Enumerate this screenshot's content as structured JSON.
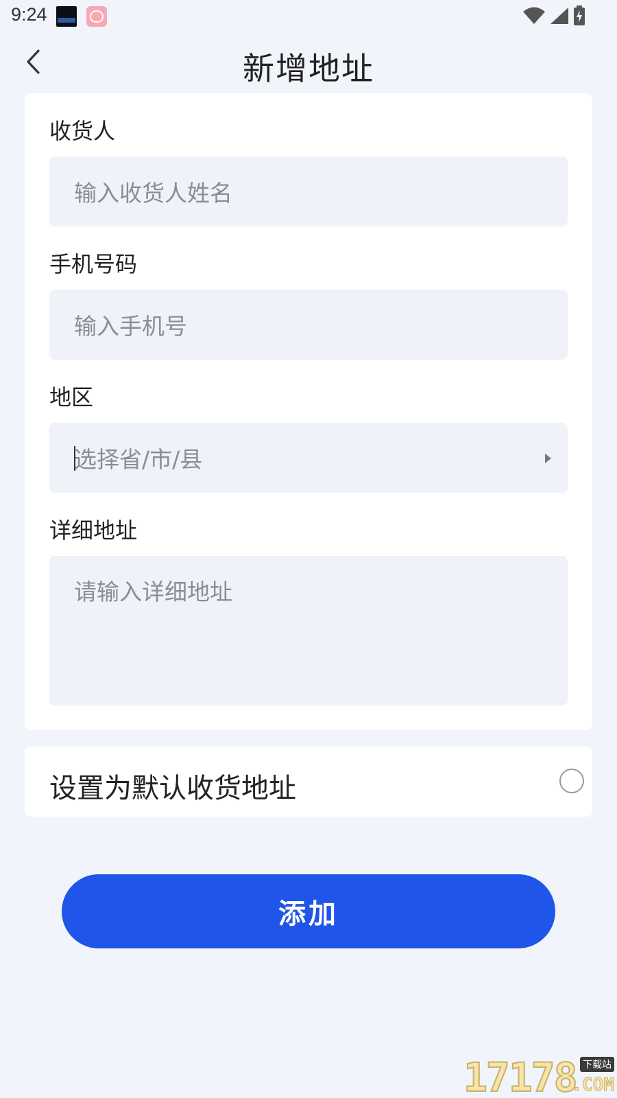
{
  "status_bar": {
    "time": "9:24",
    "icons": [
      "app-clock-icon",
      "app-rice-icon",
      "wifi-icon",
      "signal-icon",
      "battery-charging-icon"
    ]
  },
  "header": {
    "title": "新增地址",
    "back_icon": "chevron-left-icon"
  },
  "form": {
    "recipient": {
      "label": "收货人",
      "placeholder": "输入收货人姓名",
      "value": ""
    },
    "phone": {
      "label": "手机号码",
      "placeholder": "输入手机号",
      "value": ""
    },
    "region": {
      "label": "地区",
      "placeholder": "选择省/市/县",
      "value": "",
      "icon": "arrow-right-icon"
    },
    "detail": {
      "label": "详细地址",
      "placeholder": "请输入详细地址",
      "value": ""
    }
  },
  "default_setting": {
    "label": "设置为默认收货地址",
    "checked": false
  },
  "actions": {
    "add_label": "添加"
  },
  "watermark": {
    "number": "17178",
    "tag": "下载站",
    "suffix": ".COM"
  },
  "colors": {
    "background": "#f1f4fa",
    "card": "#ffffff",
    "input_bg": "#eff2f8",
    "primary": "#1f55e8",
    "placeholder": "#8a8d94"
  }
}
